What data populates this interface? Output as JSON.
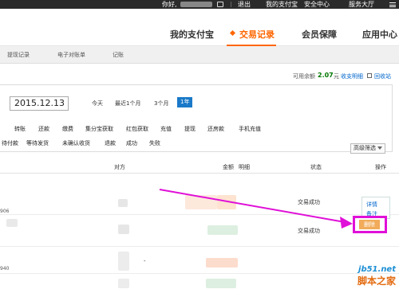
{
  "topbar": {
    "greeting": "你好,",
    "exit": "退出",
    "my_alipay": "我的支付宝",
    "security": "安全中心",
    "service_hall": "服务大厅"
  },
  "header": {
    "nav": [
      "我的支付宝",
      "交易记录",
      "会员保障",
      "应用中心"
    ],
    "active_index": 1
  },
  "subnav": {
    "items": [
      "提现记录",
      "电子对账单",
      "记账"
    ]
  },
  "balance": {
    "label": "可用余额",
    "amount": "2.07",
    "unit": "元",
    "detail_link": "收支明细",
    "recycle_link": "回收站"
  },
  "filter": {
    "date_value": "2015.12.13",
    "ranges": [
      "今天",
      "最近1个月",
      "3个月",
      "1年"
    ],
    "active_range": "1年",
    "types": [
      "转账",
      "还款",
      "缴费",
      "集分宝获取",
      "红包获取",
      "充值",
      "提现",
      "还房款",
      "手机充值"
    ],
    "statuses": [
      "待付款",
      "等待发货",
      "未确认收货",
      "退款",
      "成功",
      "失败"
    ],
    "advanced_button": "高级筛选"
  },
  "table": {
    "headers": [
      "对方",
      "金额",
      "明细",
      "状态",
      "操作"
    ],
    "rows": [
      {
        "num": "906",
        "status": "交易成功"
      },
      {
        "num": "",
        "status": "交易成功"
      },
      {
        "num": "940",
        "status": ""
      },
      {
        "num": "",
        "status": ""
      }
    ],
    "actions": [
      "详情",
      "备注"
    ],
    "delete_label": "删除",
    "dash": "-"
  },
  "watermark": {
    "url": "jb51.net",
    "name": "脚本之家"
  },
  "colors": {
    "accent": "#ff6600",
    "highlight": "#e010d8",
    "link": "#0066cc",
    "active_range_bg": "#1a79c8"
  }
}
